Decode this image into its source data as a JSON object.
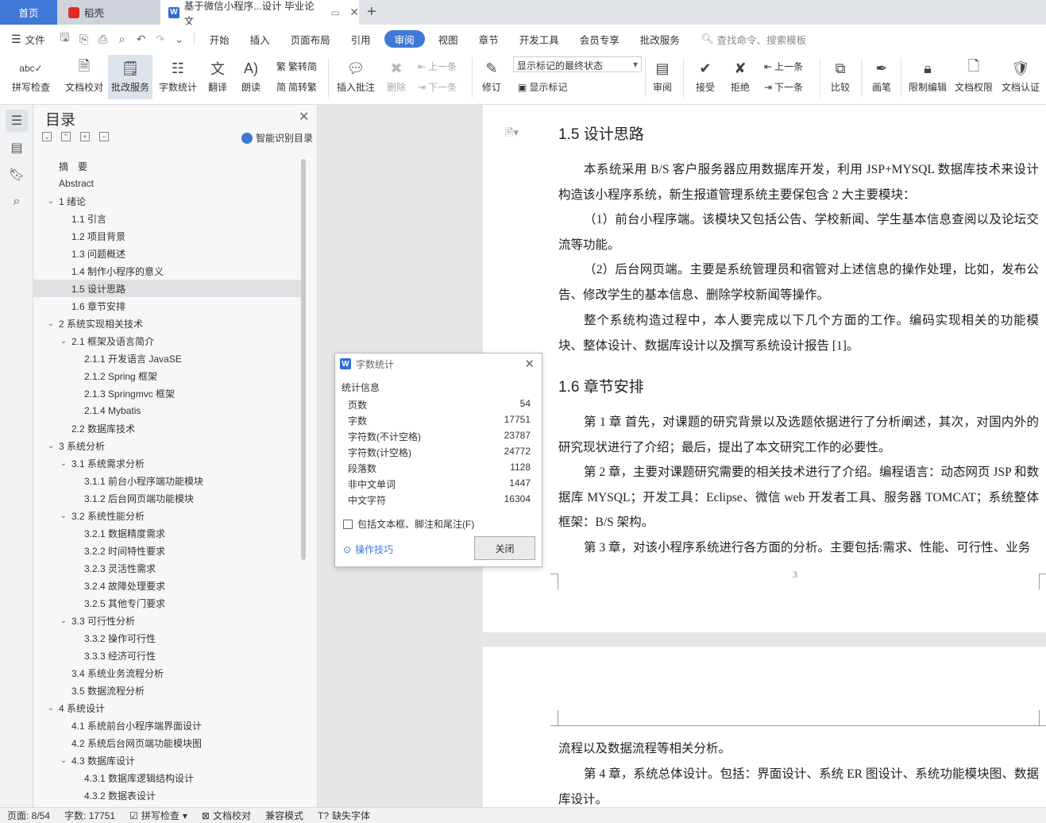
{
  "tabs": {
    "home": "首页",
    "daoke": "稻壳",
    "doc": "基于微信小程序...设计 毕业论文"
  },
  "menu": {
    "file": "文件",
    "items": [
      "开始",
      "插入",
      "页面布局",
      "引用",
      "审阅",
      "视图",
      "章节",
      "开发工具",
      "会员专享",
      "批改服务"
    ],
    "active": "审阅",
    "search": "查找命令、搜索模板"
  },
  "ribbon": {
    "spell": "拼写检查",
    "proof": "文档校对",
    "correct": "批改服务",
    "wordcount": "字数统计",
    "translate": "翻译",
    "read": "朗读",
    "t2s": "繁转简",
    "s2t": "简转繁",
    "insert_comment": "插入批注",
    "delete": "删除",
    "prev": "上一条",
    "next": "下一条",
    "revise": "修订",
    "markup_state": "显示标记的最终状态",
    "show_markup": "显示标记",
    "review": "审阅",
    "accept": "接受",
    "reject": "拒绝",
    "prev2": "上一条",
    "next2": "下一条",
    "compare": "比较",
    "pen": "画笔",
    "restrict": "限制编辑",
    "doc_perm": "文档权限",
    "doc_auth": "文档认证"
  },
  "toc": {
    "title": "目录",
    "smart": "智能识别目录",
    "items": [
      {
        "t": "摘　要",
        "lvl": 1
      },
      {
        "t": "Abstract",
        "lvl": 1
      },
      {
        "t": "1 绪论",
        "lvl": 1,
        "car": "v"
      },
      {
        "t": "1.1 引言",
        "lvl": 2
      },
      {
        "t": "1.2 项目背景",
        "lvl": 2
      },
      {
        "t": "1.3 问题概述",
        "lvl": 2
      },
      {
        "t": "1.4 制作小程序的意义",
        "lvl": 2
      },
      {
        "t": "1.5 设计思路",
        "lvl": 2,
        "sel": true
      },
      {
        "t": "1.6 章节安排",
        "lvl": 2
      },
      {
        "t": "2 系统实现相关技术",
        "lvl": 1,
        "car": "v"
      },
      {
        "t": "2.1 框架及语言简介",
        "lvl": 2,
        "car": "v"
      },
      {
        "t": "2.1.1 开发语言 JavaSE",
        "lvl": 3
      },
      {
        "t": "2.1.2 Spring 框架",
        "lvl": 3
      },
      {
        "t": "2.1.3 Springmvc 框架",
        "lvl": 3
      },
      {
        "t": "2.1.4 Mybatis",
        "lvl": 3
      },
      {
        "t": "2.2 数据库技术",
        "lvl": 2
      },
      {
        "t": "3 系统分析",
        "lvl": 1,
        "car": "v"
      },
      {
        "t": "3.1 系统需求分析",
        "lvl": 2,
        "car": "v"
      },
      {
        "t": "3.1.1 前台小程序端功能模块",
        "lvl": 3
      },
      {
        "t": "3.1.2 后台网页端功能模块",
        "lvl": 3
      },
      {
        "t": "3.2 系统性能分析",
        "lvl": 2,
        "car": "v"
      },
      {
        "t": "3.2.1 数据精度需求",
        "lvl": 3
      },
      {
        "t": "3.2.2 时间特性要求",
        "lvl": 3
      },
      {
        "t": "3.2.3 灵活性需求",
        "lvl": 3
      },
      {
        "t": "3.2.4 故障处理要求",
        "lvl": 3
      },
      {
        "t": "3.2.5 其他专门要求",
        "lvl": 3
      },
      {
        "t": "3.3 可行性分析",
        "lvl": 2,
        "car": "v"
      },
      {
        "t": "3.3.2 操作可行性",
        "lvl": 3
      },
      {
        "t": "3.3.3 经济可行性",
        "lvl": 3
      },
      {
        "t": "3.4 系统业务流程分析",
        "lvl": 2
      },
      {
        "t": "3.5 数据流程分析",
        "lvl": 2
      },
      {
        "t": "4 系统设计",
        "lvl": 1,
        "car": "v"
      },
      {
        "t": "4.1 系统前台小程序端界面设计",
        "lvl": 2
      },
      {
        "t": "4.2 系统后台网页端功能模块图",
        "lvl": 2
      },
      {
        "t": "4.3 数据库设计",
        "lvl": 2,
        "car": "v"
      },
      {
        "t": "4.3.1 数据库逻辑结构设计",
        "lvl": 3
      },
      {
        "t": "4.3.2 数据表设计",
        "lvl": 3
      }
    ]
  },
  "doc": {
    "h15": "1.5 设计思路",
    "p1": "本系统采用 B/S 客户服务器应用数据库开发，利用 JSP+MYSQL 数据库技术来设计构造该小程序系统，新生报道管理系统主要保包含 2 大主要模块：",
    "p2": "（1）前台小程序端。该模块又包括公告、学校新闻、学生基本信息查阅以及论坛交流等功能。",
    "p3": "（2）后台网页端。主要是系统管理员和宿管对上述信息的操作处理，比如，发布公告、修改学生的基本信息、删除学校新闻等操作。",
    "p4": "整个系统构造过程中，本人要完成以下几个方面的工作。编码实现相关的功能模块、整体设计、数据库设计以及撰写系统设计报告 [1]。",
    "h16": "1.6 章节安排",
    "p5": "第 1 章 首先，对课题的研究背景以及选题依据进行了分析阐述，其次，对国内外的研究现状进行了介绍；最后，提出了本文研究工作的必要性。",
    "p6": "第 2 章，主要对课题研究需要的相关技术进行了介绍。编程语言：动态网页 JSP 和数据库 MYSQL；开发工具：Eclipse、微信 web 开发者工具、服务器 TOMCAT；系统整体框架：B/S 架构。",
    "p7": "第 3 章，对该小程序系统进行各方面的分析。主要包括:需求、性能、可行性、业务",
    "page_num": "3",
    "p8": "流程以及数据流程等相关分析。",
    "p9": "第 4 章，系统总体设计。包括：界面设计、系统 ER 图设计、系统功能模块图、数据库设计。"
  },
  "dialog": {
    "title": "字数统计",
    "subtitle": "统计信息",
    "rows": [
      {
        "k": "页数",
        "v": "54"
      },
      {
        "k": "字数",
        "v": "17751"
      },
      {
        "k": "字符数(不计空格)",
        "v": "23787"
      },
      {
        "k": "字符数(计空格)",
        "v": "24772"
      },
      {
        "k": "段落数",
        "v": "1128"
      },
      {
        "k": "非中文单词",
        "v": "1447"
      },
      {
        "k": "中文字符",
        "v": "16304"
      }
    ],
    "checkbox": "包括文本框、脚注和尾注(F)",
    "tips": "操作技巧",
    "close": "关闭"
  },
  "status": {
    "page": "页面: 8/54",
    "words": "字数: 17751",
    "spell": "拼写检查",
    "proof": "文档校对",
    "compat": "兼容模式",
    "missing_font": "缺失字体"
  }
}
